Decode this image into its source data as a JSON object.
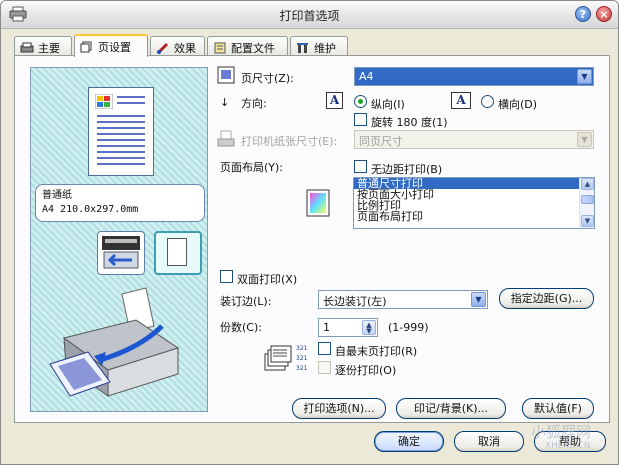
{
  "window": {
    "title": "打印首选项"
  },
  "tabs": [
    {
      "label": "主要",
      "icon": "printer-icon"
    },
    {
      "label": "页设置",
      "icon": "pages-icon"
    },
    {
      "label": "效果",
      "icon": "brush-icon"
    },
    {
      "label": "配置文件",
      "icon": "profile-icon"
    },
    {
      "label": "维护",
      "icon": "tools-icon"
    }
  ],
  "preview": {
    "paper_name": "普通纸",
    "paper_size": "A4 210.0x297.0mm"
  },
  "page_setup": {
    "page_size_label": "页尺寸(Z):",
    "page_size_value": "A4",
    "orientation_label": "方向:",
    "portrait_label": "纵向(I)",
    "landscape_label": "横向(D)",
    "rotate_label": "旋转 180 度(1)",
    "printer_paper_label": "打印机纸张尺寸(E):",
    "printer_paper_value": "同页尺寸",
    "layout_label": "页面布局(Y):",
    "borderless_label": "无边距打印(B)",
    "layout_options": [
      "普通尺寸打印",
      "按页面大小打印",
      "比例打印",
      "页面布局打印"
    ],
    "layout_selected": "普通尺寸打印",
    "duplex_label": "双面打印(X)",
    "binding_label": "装订边(L):",
    "binding_value": "长边装订(左)",
    "margin_button": "指定边距(G)...",
    "copies_label": "份数(C):",
    "copies_value": "1",
    "copies_range": "(1-999)",
    "reverse_label": "自最末页打印(R)",
    "collate_label": "逐份打印(O)",
    "print_options_button": "打印选项(N)...",
    "stamp_button": "印记/背景(K)...",
    "defaults_button": "默认值(F)"
  },
  "footer": {
    "ok": "确定",
    "cancel": "取消",
    "help": "帮助"
  },
  "watermark": {
    "cn": "小狐狸网",
    "en": "XHLKS.CN"
  }
}
